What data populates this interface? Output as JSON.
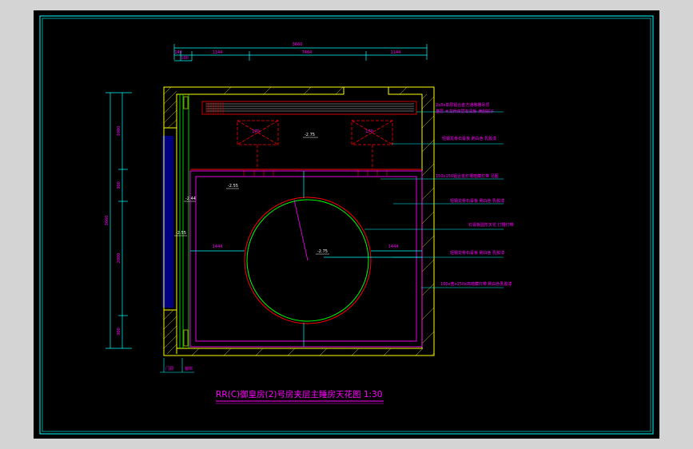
{
  "drawing": {
    "title": "RR(C)御皇房(2)号房夹层主睡房天花图 1:30",
    "colors": {
      "frame": "#00ffff",
      "wall": "#ffff00",
      "dimension": "#00ffff",
      "annotation": "#ff00ff",
      "ceiling_outline": "#ff00ff",
      "circle_outer": "#ff0000",
      "circle_inner": "#00ff00",
      "curtain": "#0000ff",
      "leader": "#00ffff",
      "pipe": "#ff0000"
    },
    "top_dimensions": {
      "overall": "3660",
      "segments": [
        "140",
        "1144",
        "7464",
        "1144"
      ],
      "small": "100"
    },
    "left_dimensions": {
      "overall": "3660",
      "segments": [
        "1000",
        "300",
        "2000",
        "300"
      ]
    },
    "levels": {
      "upper": "-2.75",
      "left_a": "-2.55",
      "left_b": "-2.44",
      "left_c": "-2.55",
      "center": "-2.75"
    },
    "diffuser_labels": [
      "170",
      "170"
    ],
    "inner_dimensions": {
      "left": "1444",
      "right": "1444"
    },
    "annotations": [
      "2x8x单层铝合金方通格栅吊顶",
      "基层 木龙骨双层石膏板 满刮腻子",
      "轻钢龙骨石膏板 刷白色 乳胶漆",
      "150x150铝合金灯槽暗藏灯带 见图",
      "轻钢龙骨石膏板 刷白色 乳胶漆",
      "石膏板圆形天花 灯槽灯带",
      "轻钢龙骨石膏板 刷白色 乳胶漆",
      "100x宽x150x高暗藏灯带 刷白色乳胶漆"
    ],
    "bottom_labels": [
      "门洞",
      "窗帘"
    ]
  }
}
